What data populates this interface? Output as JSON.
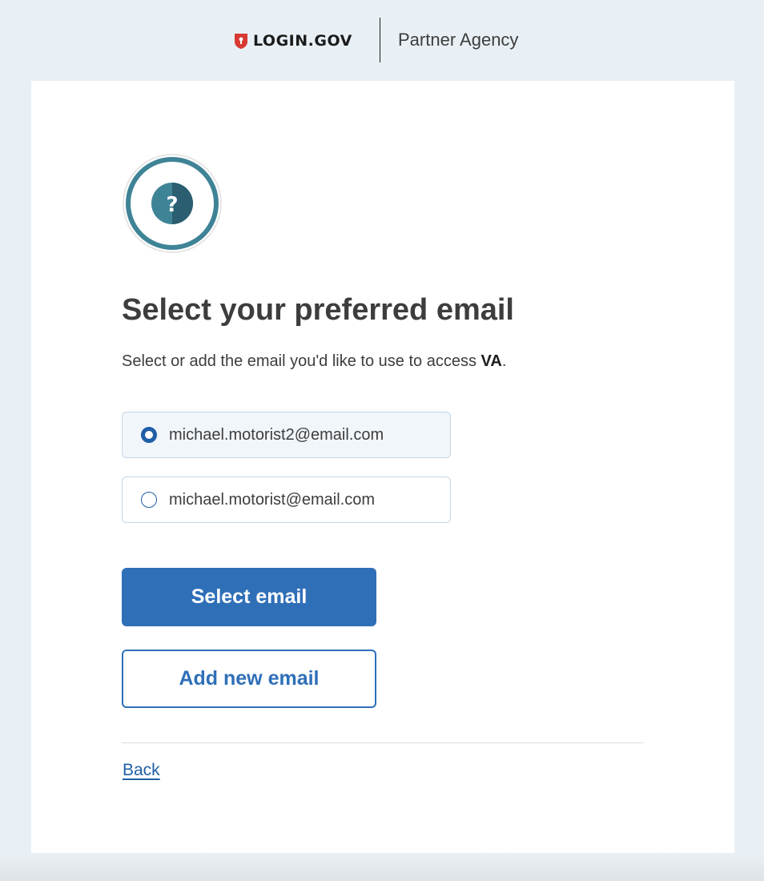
{
  "header": {
    "brand_label": "LOGIN.GOV",
    "partner_label": "Partner Agency"
  },
  "status_icon": {
    "icon": "question-icon",
    "glyph": "?"
  },
  "main": {
    "heading": "Select your preferred email",
    "intro_prefix": "Select or add the email you'd like to use to access ",
    "intro_agency": "VA",
    "intro_suffix": ".",
    "email_options": [
      {
        "label": "michael.motorist2@email.com",
        "selected": true
      },
      {
        "label": "michael.motorist@email.com",
        "selected": false
      }
    ],
    "select_button_label": "Select email",
    "add_button_label": "Add new email",
    "back_link_label": "Back"
  },
  "colors": {
    "primary": "#2f6fb8",
    "background": "#e9f0f5",
    "brand_red": "#d83933",
    "icon_teal": "#3f8396"
  }
}
